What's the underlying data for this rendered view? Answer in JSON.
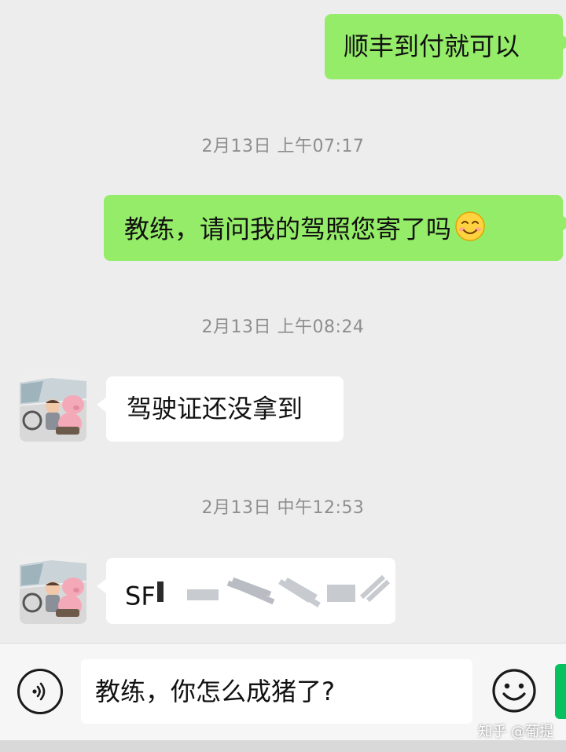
{
  "messages": [
    {
      "side": "me",
      "text": "顺丰到付就可以"
    },
    {
      "timestamp": "2月13日 上午07:17"
    },
    {
      "side": "me",
      "text": "教练，请问我的驾照您寄了吗",
      "emoji": "smiling-face"
    },
    {
      "timestamp": "2月13日 上午08:24"
    },
    {
      "side": "them",
      "text": "驾驶证还没拿到",
      "avatar": "pig-driver-avatar"
    },
    {
      "timestamp": "2月13日 中午12:53"
    },
    {
      "side": "them",
      "text": "SF",
      "redacted": true,
      "avatar": "pig-driver-avatar"
    }
  ],
  "input": {
    "value": "教练，你怎么成猪了?"
  },
  "icons": {
    "voice": "voice-icon",
    "emoji": "emoji-icon"
  },
  "watermark": "知乎 @葡提",
  "colors": {
    "my_bubble": "#95ec69",
    "their_bubble": "#ffffff",
    "background": "#ededed",
    "send_button": "#07c160"
  }
}
